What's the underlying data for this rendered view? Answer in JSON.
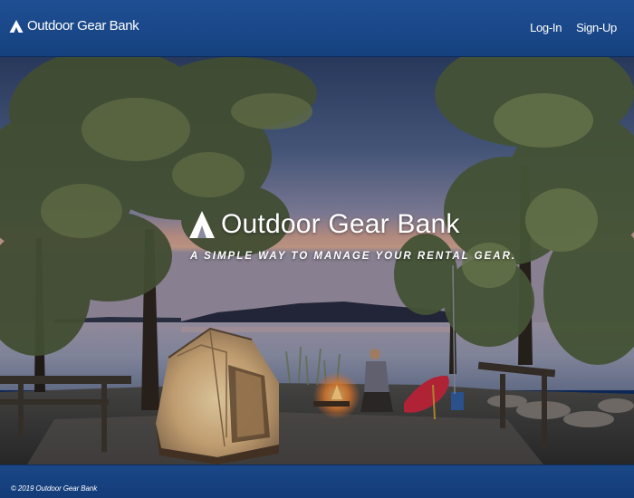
{
  "header": {
    "brand_name": "Outdoor Gear Bank",
    "brand_icon": "mountain-icon",
    "nav": {
      "login_label": "Log-In",
      "signup_label": "Sign-Up"
    }
  },
  "hero": {
    "title": "Outdoor Gear Bank",
    "tagline": "A SIMPLE WAY TO MANAGE YOUR RENTAL GEAR.",
    "icon": "mountain-icon"
  },
  "footer": {
    "copyright": "© 2019 Outdoor Gear Bank"
  },
  "colors": {
    "navbar": "#1f4f93",
    "footer": "#1a4788",
    "text": "#ffffff"
  }
}
